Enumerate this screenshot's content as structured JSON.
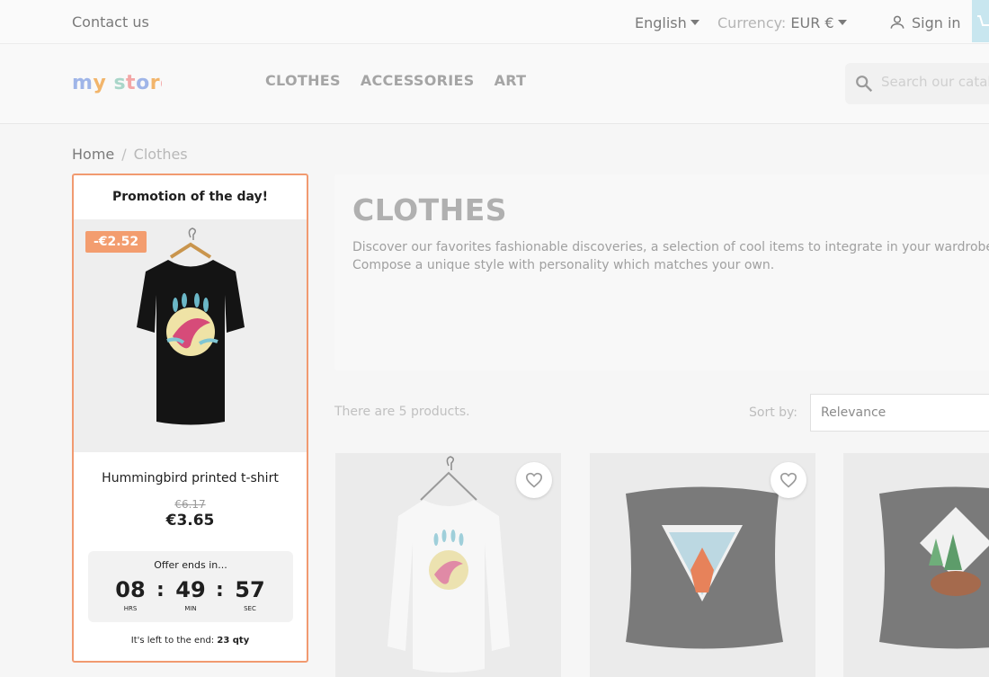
{
  "topbar": {
    "contact": "Contact us",
    "language": "English",
    "currency_label": "Currency:",
    "currency_value": "EUR €",
    "signin": "Sign in"
  },
  "header": {
    "logo": "my store",
    "menu": [
      "CLOTHES",
      "ACCESSORIES",
      "ART"
    ],
    "search_placeholder": "Search our catalog"
  },
  "breadcrumb": {
    "home": "Home",
    "separator": "/",
    "current": "Clothes"
  },
  "promo": {
    "title": "Promotion of the day!",
    "discount": "-€2.52",
    "product_name": "Hummingbird printed t-shirt",
    "old_price": "€6.17",
    "new_price": "€3.65",
    "offer_text": "Offer ends in...",
    "hours": "08",
    "minutes": "49",
    "seconds": "57",
    "hours_label": "HRS",
    "minutes_label": "MIN",
    "seconds_label": "SEC",
    "left_text": "It's left to the end:",
    "left_qty": "23 qty"
  },
  "category": {
    "title": "CLOTHES",
    "description_line1": "Discover our favorites fashionable discoveries, a selection of cool items to integrate in your wardrobe.",
    "description_line2": "Compose a unique style with personality which matches your own."
  },
  "listing": {
    "count_text": "There are 5 products.",
    "sort_label": "Sort by:",
    "sort_value": "Relevance"
  },
  "colors": {
    "accent": "#f19a70",
    "discount_badge": "#f39d6f"
  },
  "icons": [
    "user-icon",
    "search-icon",
    "heart-icon",
    "cart-icon",
    "chevron-down-icon"
  ]
}
